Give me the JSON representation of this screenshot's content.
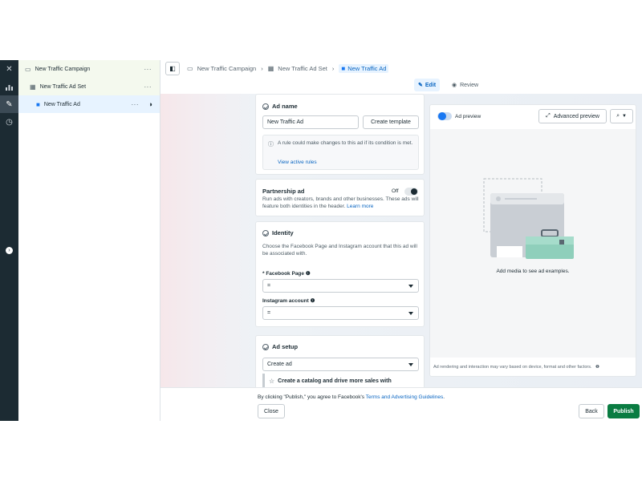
{
  "tree": {
    "campaign": "New Traffic Campaign",
    "ad_set": "New Traffic Ad Set",
    "ad": "New Traffic Ad",
    "more": "···"
  },
  "breadcrumb": [
    "New Traffic Campaign",
    "New Traffic Ad Set",
    "New Traffic Ad"
  ],
  "modes": {
    "edit": "Edit",
    "review": "Review"
  },
  "ad_name": {
    "title": "Ad name",
    "value": "New Traffic Ad",
    "create_template": "Create template",
    "notice": "A rule could make changes to this ad if its condition is met.",
    "view_rules": "View active rules"
  },
  "partnership": {
    "title": "Partnership ad",
    "state": "Off",
    "desc": "Run ads with creators, brands and other businesses. These ads will feature both identities in the header.",
    "learn_more": "Learn more"
  },
  "identity": {
    "title": "Identity",
    "desc": "Choose the Facebook Page and Instagram account that this ad will be associated with.",
    "fb_label": "* Facebook Page",
    "fb_value": "=",
    "ig_label": "Instagram account",
    "ig_value": "="
  },
  "ad_setup": {
    "title": "Ad setup",
    "select_value": "Create ad",
    "catalog": "Create a catalog and drive more sales with"
  },
  "preview": {
    "toggle_label": "Ad preview",
    "advanced": "Advanced preview",
    "empty": "Add media to see ad examples.",
    "disclaimer": "Ad rendering and interaction may vary based on device, format and other factors."
  },
  "footer": {
    "notice_prefix": "By clicking \"Publish,\" you agree to Facebook's",
    "terms_link": "Terms and Advertising Guidelines",
    "notice_suffix": ".",
    "close": "Close",
    "back": "Back",
    "publish": "Publish"
  },
  "colors": {
    "publish": "#0a7c42",
    "accent": "#1877f2",
    "rail": "#1c2b33"
  }
}
